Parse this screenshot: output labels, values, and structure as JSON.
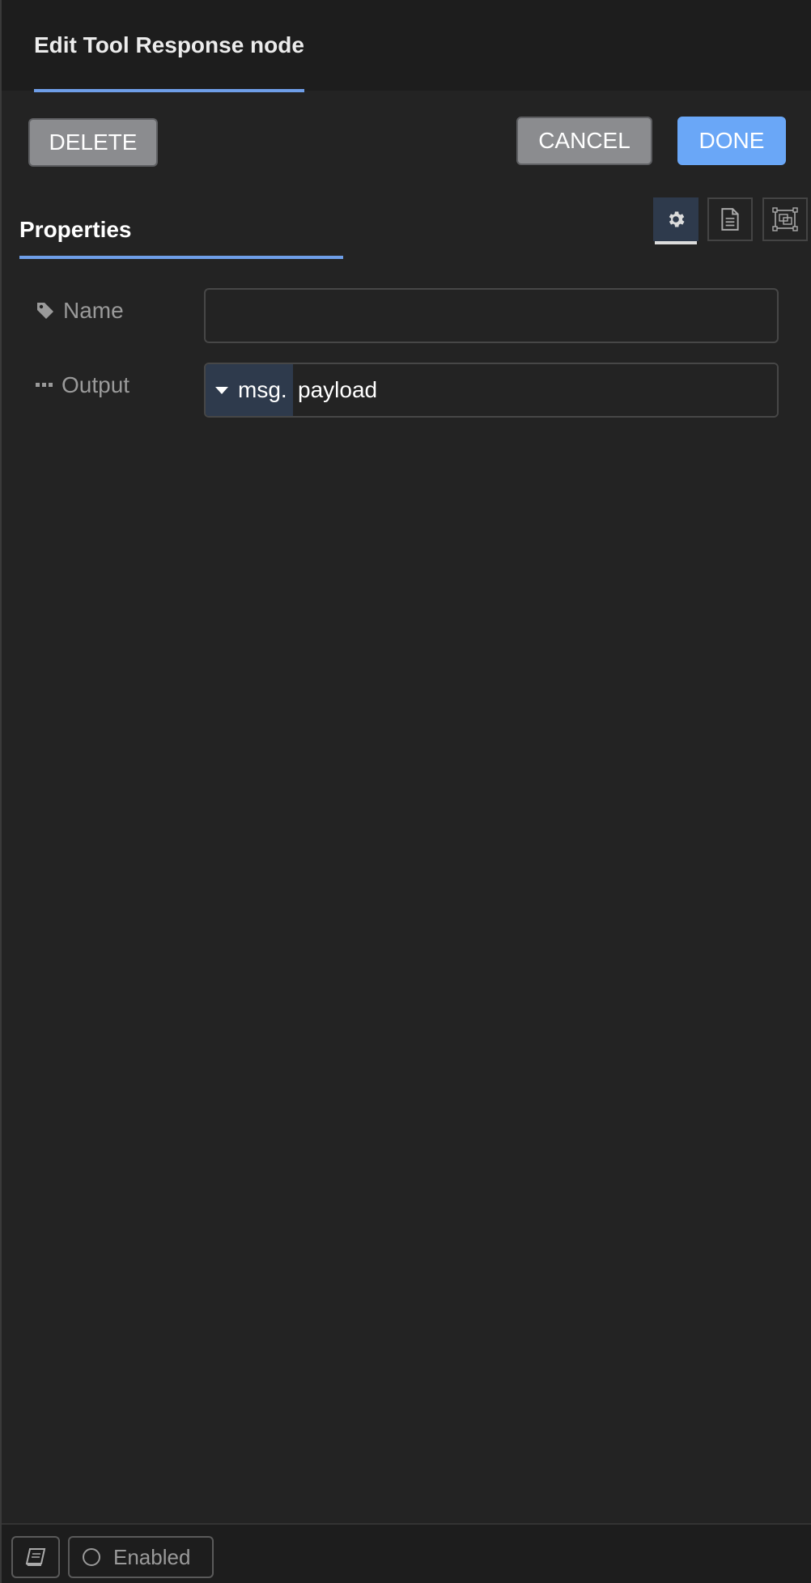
{
  "header": {
    "title": "Edit Tool Response node"
  },
  "toolbar": {
    "delete_label": "DELETE",
    "cancel_label": "CANCEL",
    "done_label": "DONE"
  },
  "tabs": {
    "properties_label": "Properties",
    "icons": [
      "gear-icon",
      "document-icon",
      "appearance-icon"
    ]
  },
  "form": {
    "name": {
      "label": "Name",
      "value": "",
      "icon": "tag-icon"
    },
    "output": {
      "label": "Output",
      "icon": "ellipsis-icon",
      "type_prefix": "msg.",
      "value": "payload"
    }
  },
  "footer": {
    "help_icon": "book-icon",
    "enabled_label": "Enabled"
  },
  "colors": {
    "accent": "#6e9ee8",
    "done_button": "#6aa7f7",
    "background": "#232323"
  }
}
